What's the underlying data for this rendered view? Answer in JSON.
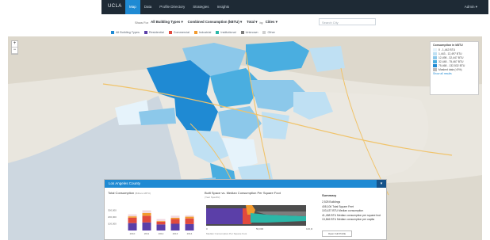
{
  "nav": {
    "brand": "UCLA",
    "items": [
      "Map",
      "Data",
      "Profile Directory",
      "Strategies",
      "Insights"
    ],
    "active_index": 0,
    "user_menu": "Admin ▾"
  },
  "filters": {
    "show_for_label": "Show For",
    "building_types": "All Building Types ▾",
    "metric": "Combined Consumption (kBTU) ▾",
    "total": "Total ▾",
    "by_label": "by",
    "geography": "Cities ▾",
    "search_placeholder": "Search City"
  },
  "building_legend": [
    {
      "label": "All Building Types",
      "color": "#1f8ad3"
    },
    {
      "label": "Residential",
      "color": "#5b3fa8"
    },
    {
      "label": "Commercial",
      "color": "#e14a3d"
    },
    {
      "label": "Industrial",
      "color": "#f29a2e"
    },
    {
      "label": "Institutional",
      "color": "#2bb7a8"
    },
    {
      "label": "Unknown",
      "color": "#7d7d7d"
    },
    {
      "label": "Other",
      "color": "#cfcfcf"
    }
  ],
  "map_legend": {
    "title": "Consumption in kBTU",
    "items": [
      {
        "label": "0 - 1,442 BTU",
        "color": "#e6f3fb"
      },
      {
        "label": "1,443 - 12,497 BTU",
        "color": "#bfe0f3"
      },
      {
        "label": "12,498 - 32,447 BTU",
        "color": "#8cc8ea"
      },
      {
        "label": "32,448 - 75,467 BTU",
        "color": "#4aaee0"
      },
      {
        "label": "75,468 - 132,532 BTU",
        "color": "#1f8ad3"
      }
    ],
    "masked": "Masked data (<5%)",
    "show_all": "Show all results"
  },
  "panel": {
    "title": "Los Angeles County",
    "total_title": "Total Consumption",
    "total_sub": "(Billions kBTU)",
    "built_title": "Built Space vs. Median Consumption Per Square Foot",
    "built_sub": "(Year Specific)",
    "built_xlabel": "Median Consumption Per Square Foot",
    "summary_title": "Summary",
    "summary": [
      "2,525 Buildings",
      "408,106 Total Square Feet",
      "103,437 BTU Median consumption",
      "41,458 BTU Median consumption per square foot",
      "13,846 BTU Median consumption per capita"
    ],
    "summary_button": "Open Full Profile"
  },
  "chart_data": [
    {
      "type": "bar",
      "title": "Total Consumption",
      "categories": [
        "2010",
        "2011",
        "2012",
        "2013",
        "2014"
      ],
      "series": [
        {
          "name": "Residential",
          "color": "#5b3fa8",
          "values": [
            110,
            120,
            90,
            100,
            95
          ]
        },
        {
          "name": "Commercial",
          "color": "#e14a3d",
          "values": [
            80,
            100,
            40,
            70,
            85
          ]
        },
        {
          "name": "Industrial",
          "color": "#f29a2e",
          "values": [
            20,
            40,
            10,
            20,
            25
          ]
        },
        {
          "name": "Other",
          "color": "#f2d8e0",
          "values": [
            30,
            40,
            30,
            30,
            20
          ]
        }
      ],
      "ylim": [
        0,
        400
      ],
      "ytick_labels": [
        "100,000",
        "200,000",
        "300,000"
      ]
    },
    {
      "type": "area",
      "title": "Built Space vs. Median Consumption Per Square Foot",
      "xtick_labels": [
        "0",
        "50,000",
        "100,000"
      ],
      "series": [
        {
          "name": "Residential",
          "color": "#5b3fa8"
        },
        {
          "name": "Commercial",
          "color": "#e14a3d"
        },
        {
          "name": "Industrial",
          "color": "#f29a2e"
        },
        {
          "name": "Institutional",
          "color": "#2bb7a8"
        },
        {
          "name": "Unknown",
          "color": "#7d7d7d"
        }
      ]
    }
  ]
}
